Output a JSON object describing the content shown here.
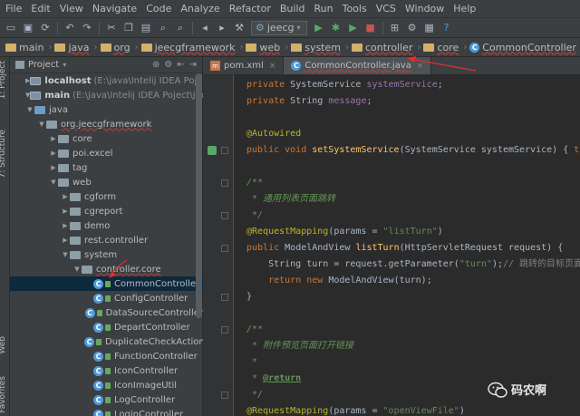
{
  "menubar": {
    "items": [
      "File",
      "Edit",
      "View",
      "Navigate",
      "Code",
      "Analyze",
      "Refactor",
      "Build",
      "Run",
      "Tools",
      "VCS",
      "Window",
      "Help"
    ]
  },
  "toolbar": {
    "run_config": "jeecg"
  },
  "breadcrumbs": {
    "items": [
      "main",
      "java",
      "org",
      "jeecgframework",
      "web",
      "system",
      "controller",
      "core",
      "CommonController"
    ]
  },
  "sidebar_tabs": {
    "project": "1: Project",
    "structure": "7: Structure",
    "web": "Web",
    "favorites": "2: Favorites"
  },
  "project_panel": {
    "title": "Project",
    "rows": [
      {
        "label": "localhost",
        "suffix": "(E:\\java\\Intelij IDEA Poject\\jee",
        "kind": "module",
        "expanded": false
      },
      {
        "label": "main",
        "suffix": "(E:\\java\\Intelij IDEA Poject\\jeecg-t",
        "kind": "module",
        "expanded": true
      },
      {
        "label": "java",
        "kind": "folder-blue",
        "expanded": true
      },
      {
        "label": "org.jeecgframework",
        "kind": "package",
        "expanded": true
      },
      {
        "label": "core",
        "kind": "package",
        "expanded": false
      },
      {
        "label": "poi.excel",
        "kind": "package",
        "expanded": false
      },
      {
        "label": "tag",
        "kind": "package",
        "expanded": false
      },
      {
        "label": "web",
        "kind": "package",
        "expanded": true
      },
      {
        "label": "cgform",
        "kind": "package",
        "expanded": false
      },
      {
        "label": "cgreport",
        "kind": "package",
        "expanded": false
      },
      {
        "label": "demo",
        "kind": "package",
        "expanded": false
      },
      {
        "label": "rest.controller",
        "kind": "package",
        "expanded": false
      },
      {
        "label": "system",
        "kind": "package",
        "expanded": true
      },
      {
        "label": "controller.core",
        "kind": "package",
        "expanded": true
      },
      {
        "label": "CommonController",
        "kind": "class",
        "selected": true
      },
      {
        "label": "ConfigController",
        "kind": "class"
      },
      {
        "label": "DataSourceController",
        "kind": "class"
      },
      {
        "label": "DepartController",
        "kind": "class"
      },
      {
        "label": "DuplicateCheckAction",
        "kind": "class"
      },
      {
        "label": "FunctionController",
        "kind": "class"
      },
      {
        "label": "IconController",
        "kind": "class"
      },
      {
        "label": "IconImageUtil",
        "kind": "class"
      },
      {
        "label": "LogController",
        "kind": "class"
      },
      {
        "label": "LoginController",
        "kind": "class"
      }
    ]
  },
  "editor": {
    "tabs": [
      {
        "label": "pom.xml",
        "active": false
      },
      {
        "label": "CommonController.java",
        "active": true
      }
    ],
    "lines": [
      [
        [
          "k",
          "private "
        ],
        [
          "t",
          "SystemService "
        ],
        [
          "f",
          "systemService"
        ],
        [
          "t",
          ";"
        ]
      ],
      [
        [
          "k",
          "private "
        ],
        [
          "t",
          "String "
        ],
        [
          "f",
          "message"
        ],
        [
          "t",
          ";"
        ]
      ],
      [],
      [
        [
          "a",
          "@Autowired"
        ]
      ],
      [
        [
          "k",
          "public void "
        ],
        [
          "fn",
          "setSystemService"
        ],
        [
          "t",
          "(SystemService systemService) { "
        ],
        [
          "k",
          "this"
        ]
      ],
      [],
      [
        [
          "c",
          "/**"
        ]
      ],
      [
        [
          "c",
          " * 通用列表页面跳转"
        ]
      ],
      [
        [
          "c",
          " */"
        ]
      ],
      [
        [
          "a",
          "@RequestMapping"
        ],
        [
          "t",
          "(params = "
        ],
        [
          "s",
          "\"listTurn\""
        ],
        [
          "t",
          ")"
        ]
      ],
      [
        [
          "k",
          "public "
        ],
        [
          "t",
          "ModelAndView "
        ],
        [
          "fn",
          "listTurn"
        ],
        [
          "t",
          "(HttpServletRequest request) {"
        ]
      ],
      [
        [
          "t",
          "    String turn = request.getParameter("
        ],
        [
          "s",
          "\"turn\""
        ],
        [
          "t",
          ");"
        ],
        [
          "cm",
          "// 跳转的目标页面"
        ]
      ],
      [
        [
          "t",
          "    "
        ],
        [
          "k",
          "return new "
        ],
        [
          "t",
          "ModelAndView(turn);"
        ]
      ],
      [
        [
          "t",
          "}"
        ]
      ],
      [],
      [
        [
          "c",
          "/**"
        ]
      ],
      [
        [
          "c",
          " * 附件预览页面打开链接"
        ]
      ],
      [
        [
          "c",
          " *"
        ]
      ],
      [
        [
          "c",
          " * "
        ],
        [
          "ct",
          "@return"
        ]
      ],
      [
        [
          "c",
          " */"
        ]
      ],
      [
        [
          "a",
          "@RequestMapping"
        ],
        [
          "t",
          "(params = "
        ],
        [
          "s",
          "\"openViewFile\""
        ],
        [
          "t",
          ")"
        ]
      ]
    ]
  },
  "watermark": {
    "text": "码农啊"
  },
  "colors": {
    "selection": "#0d293e",
    "keyword": "#cc7832",
    "annotation": "#bbb529",
    "string": "#6a8759",
    "field": "#9876aa",
    "method": "#ffc66d",
    "doc_comment": "#629755"
  }
}
